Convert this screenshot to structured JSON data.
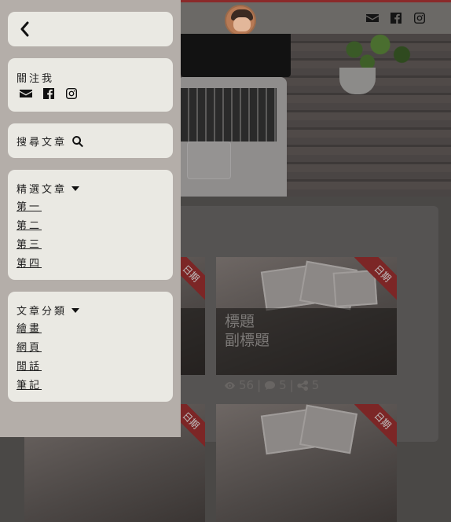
{
  "header": {
    "social_icons": [
      "envelope-icon",
      "facebook-icon",
      "instagram-icon"
    ]
  },
  "cards": [
    {
      "ribbon": "日期",
      "title": "",
      "subtitle": ""
    },
    {
      "ribbon": "日期",
      "title": "標題",
      "subtitle": "副標題"
    },
    {
      "ribbon": "日期"
    },
    {
      "ribbon": "日期"
    }
  ],
  "stats": {
    "views": "56",
    "comments": "5",
    "shares": "5"
  },
  "sidebar": {
    "back_icon": "chevron-left-icon",
    "follow_label": "關注我",
    "search_label": "搜尋文章",
    "featured": {
      "label": "精選文章",
      "items": [
        "第一",
        "第二",
        "第三",
        "第四"
      ]
    },
    "category": {
      "label": "文章分類",
      "items": [
        "繪畫",
        "網頁",
        "閒話",
        "筆記"
      ]
    }
  },
  "colors": {
    "ribbon": "#7c2626",
    "panel": "#eae9e3",
    "dim": "#b4aea9"
  }
}
